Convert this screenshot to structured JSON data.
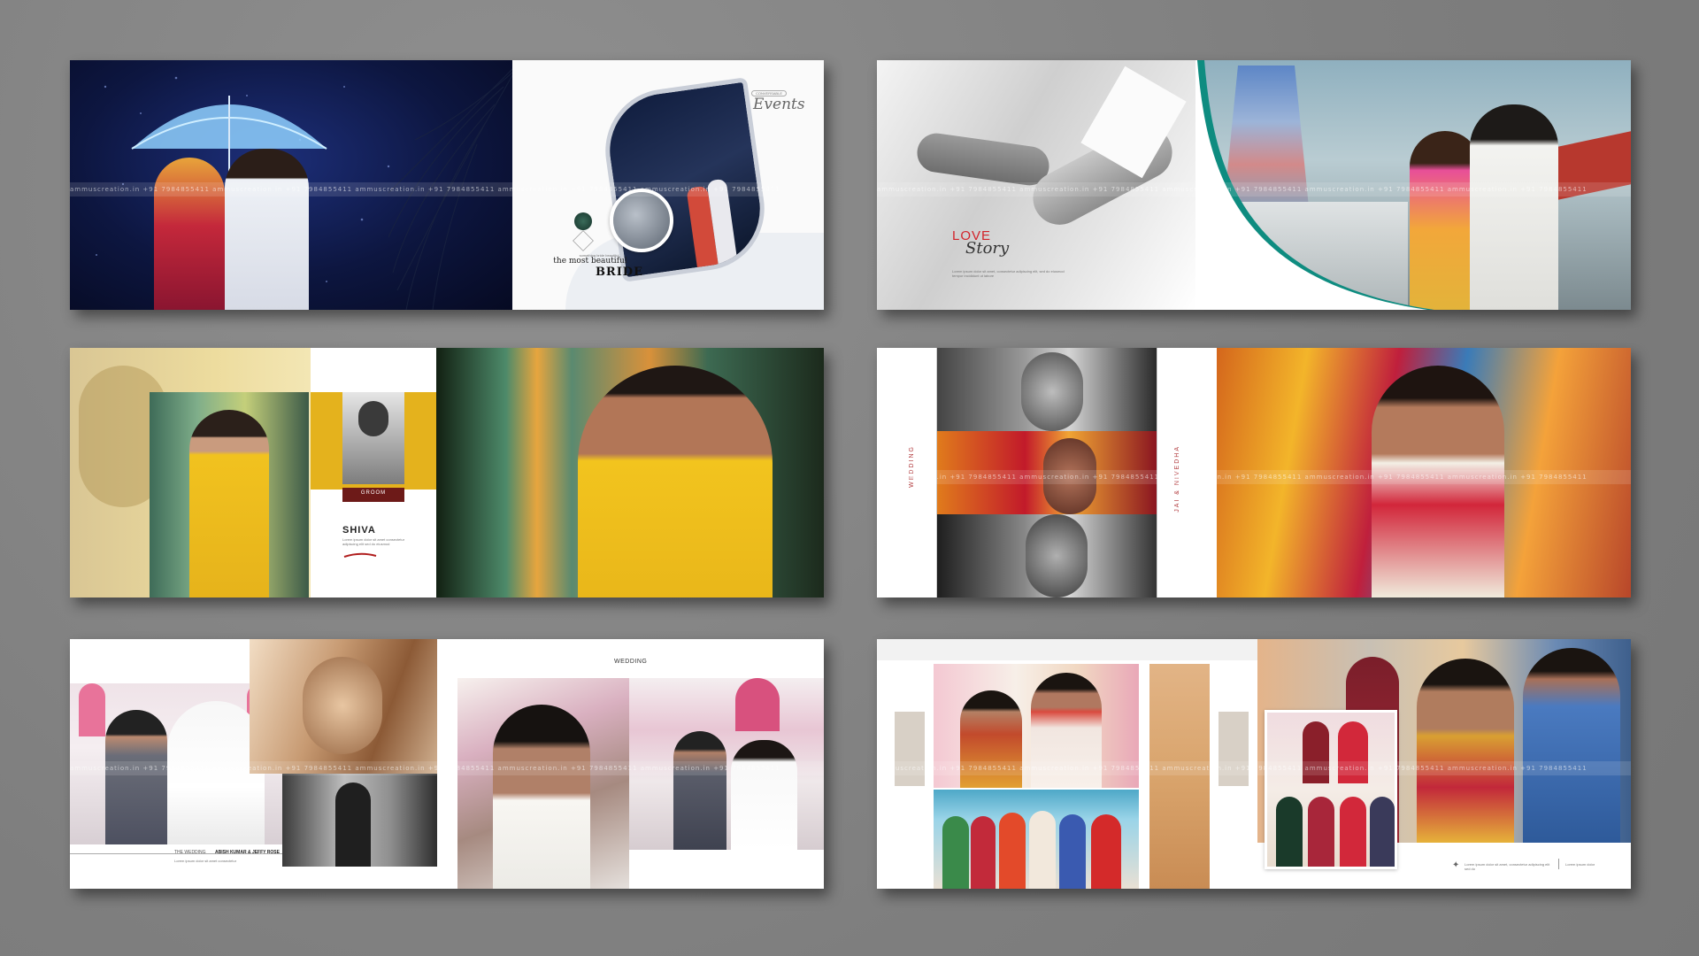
{
  "watermark_text": "ammuscreation.in  +91 7984855411   ammuscreation.in  +91 7984855411   ammuscreation.in  +91 7984855411   ammuscreation.in  +91 7984855411   ammuscreation.in  +91 7984855411",
  "spread1": {
    "logo_small": "CONVERSABLE",
    "events_label": "Events",
    "bride_small": "something bride beautiful",
    "bride_title_line1": "the most beautiful",
    "bride_title_line2": "BRIDE"
  },
  "spread2": {
    "love_label": "LOVE",
    "story_label": "Story",
    "caption": "Lorem ipsum dolor sit amet, consectetur adipiscing elit, sed do eiusmod tempor incididunt ut labore"
  },
  "spread3": {
    "groom_label": "GROOM",
    "name": "SHIVA",
    "caption": "Lorem ipsum dolor sit amet consectetur adipiscing elit sed do eiusmod"
  },
  "spread4": {
    "wedding_label": "WEDDING",
    "couple_label": "JAI & NIVEDHA"
  },
  "spread5": {
    "wedding_heading": "WEDDING",
    "footer_label": "THE WEDDING",
    "couple_names": "ABISH KUMAR & JEFFY ROSE",
    "caption": "Lorem ipsum dolor sit amet consectetur"
  },
  "spread6": {
    "side_text": "Lorem ipsum dolor sit amet",
    "footer_caption": "Lorem ipsum dolor sit amet, consectetur adipiscing elit sed do",
    "footer_right": "Lorem ipsum dolor"
  },
  "colors": {
    "background": "#858585",
    "night_blue": "#0d1640",
    "teal_accent": "#0e8c80",
    "mustard": "#e4b21d",
    "wedding_red": "#c0392b",
    "tan": "#d9a46c"
  }
}
